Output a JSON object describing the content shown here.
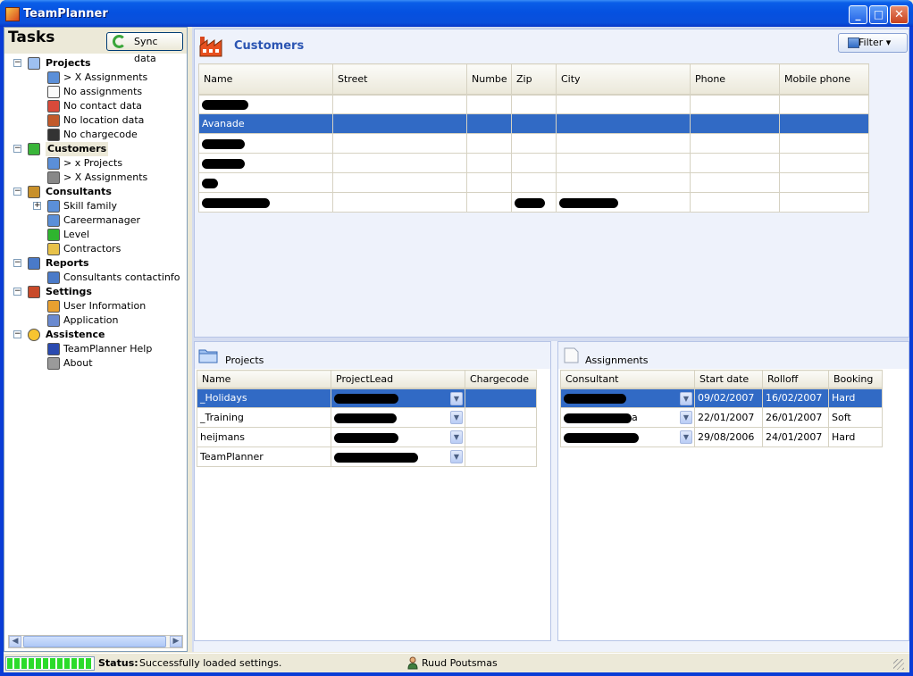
{
  "window": {
    "title": "TeamPlanner"
  },
  "tasks": {
    "title": "Tasks",
    "sync_label": "Sync data",
    "tree": [
      {
        "label": "Projects",
        "bold": true
      },
      {
        "label": "> X Assignments"
      },
      {
        "label": "No assignments"
      },
      {
        "label": "No contact data"
      },
      {
        "label": "No location data"
      },
      {
        "label": "No chargecode"
      },
      {
        "label": "Customers",
        "bold": true,
        "selected": true
      },
      {
        "label": "> x Projects"
      },
      {
        "label": "> X Assignments"
      },
      {
        "label": "Consultants",
        "bold": true
      },
      {
        "label": "Skill family"
      },
      {
        "label": "Careermanager"
      },
      {
        "label": "Level"
      },
      {
        "label": "Contractors"
      },
      {
        "label": "Reports",
        "bold": true
      },
      {
        "label": "Consultants contactinfo"
      },
      {
        "label": "Settings",
        "bold": true
      },
      {
        "label": "User Information"
      },
      {
        "label": "Application"
      },
      {
        "label": "Assistence",
        "bold": true
      },
      {
        "label": "TeamPlanner Help"
      },
      {
        "label": "About"
      }
    ]
  },
  "customers": {
    "title": "Customers",
    "filter_label": "Filter",
    "columns": [
      "Name",
      "Street",
      "Numbe",
      "Zip",
      "City",
      "Phone",
      "Mobile phone"
    ],
    "rows": [
      {
        "name": "",
        "name_redacted": true
      },
      {
        "name": "Avanade",
        "selected": true
      },
      {
        "name": "",
        "name_redacted": true
      },
      {
        "name": "",
        "name_redacted": true
      },
      {
        "name": "",
        "name_redacted": true
      },
      {
        "name": "",
        "name_redacted": true,
        "zip_redacted": true,
        "city_redacted": true
      }
    ]
  },
  "projects": {
    "title": "Projects",
    "columns": [
      "Name",
      "ProjectLead",
      "Chargecode"
    ],
    "rows": [
      {
        "name": "_Holidays",
        "selected": true
      },
      {
        "name": "_Training"
      },
      {
        "name": "heijmans"
      },
      {
        "name": "TeamPlanner"
      }
    ]
  },
  "assignments": {
    "title": "Assignments",
    "columns": [
      "Consultant",
      "Start date",
      "Rolloff",
      "Booking"
    ],
    "rows": [
      {
        "consultant_suffix": "",
        "start": "09/02/2007",
        "rolloff": "16/02/2007",
        "booking": "Hard",
        "selected": true
      },
      {
        "consultant_suffix": "a",
        "start": "22/01/2007",
        "rolloff": "26/01/2007",
        "booking": "Soft"
      },
      {
        "consultant_suffix": "",
        "start": "29/08/2006",
        "rolloff": "24/01/2007",
        "booking": "Hard"
      }
    ]
  },
  "status": {
    "label": "Status:",
    "text": "Successfully loaded settings.",
    "user": "Ruud Poutsmas",
    "progress": 1.0
  },
  "colors": {
    "titlebar": "#0a5ee8",
    "selection": "#316ac5",
    "header_text": "#2b55b3"
  }
}
